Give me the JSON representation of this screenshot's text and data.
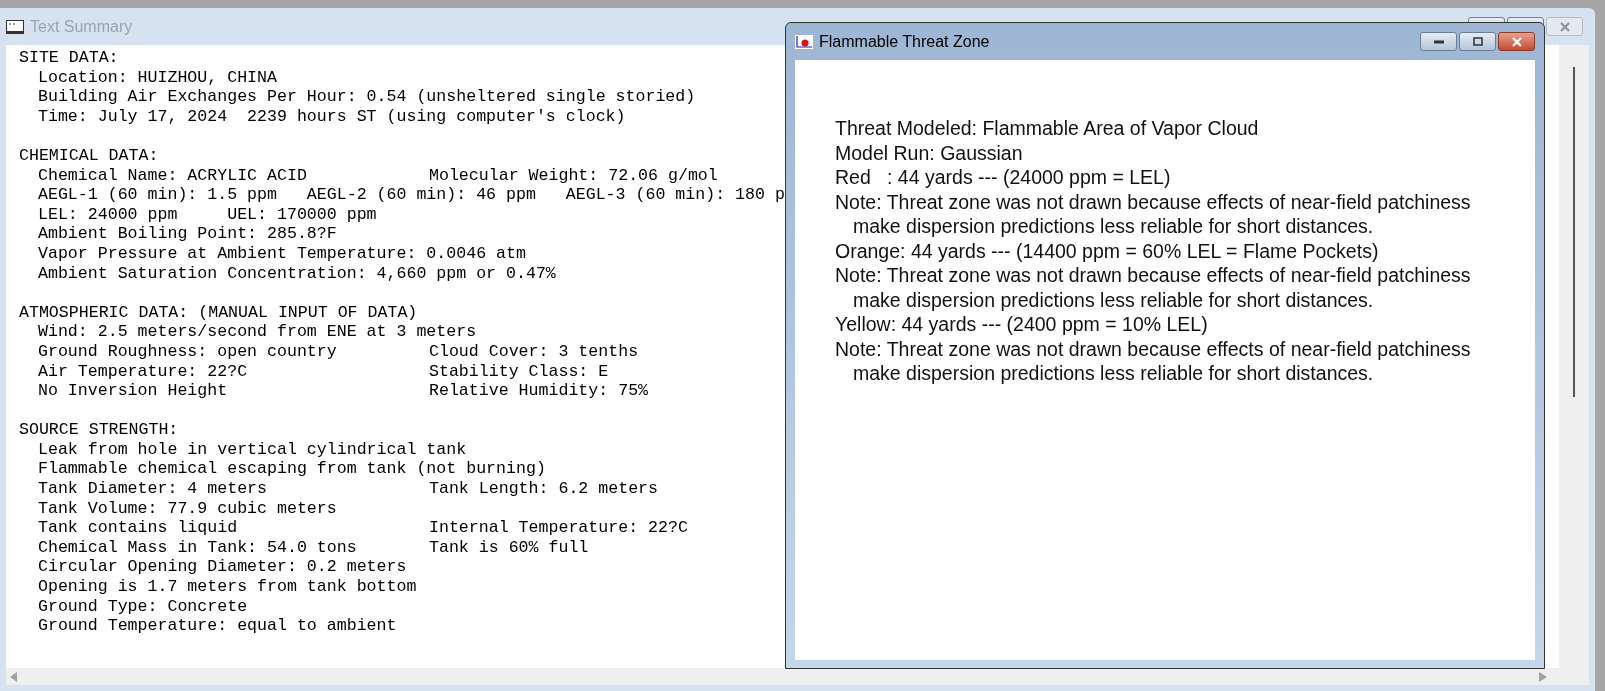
{
  "summary_window": {
    "title": "Text Summary",
    "sections": [
      {
        "heading": "SITE DATA:",
        "lines": [
          {
            "left": "Location: HUIZHOU, CHINA"
          },
          {
            "left": "Building Air Exchanges Per Hour: 0.54 (unsheltered single storied)"
          },
          {
            "left": "Time: July 17, 2024  2239 hours ST (using computer's clock)"
          }
        ]
      },
      {
        "heading": "CHEMICAL DATA:",
        "lines": [
          {
            "left": "Chemical Name: ACRYLIC ACID",
            "right": "Molecular Weight: 72.06 g/mol"
          },
          {
            "left": "AEGL-1 (60 min): 1.5 ppm   AEGL-2 (60 min): 46 ppm   AEGL-3 (60 min): 180 p"
          },
          {
            "left": "LEL: 24000 ppm     UEL: 170000 ppm"
          },
          {
            "left": "Ambient Boiling Point: 285.8?F"
          },
          {
            "left": "Vapor Pressure at Ambient Temperature: 0.0046 atm"
          },
          {
            "left": "Ambient Saturation Concentration: 4,660 ppm or 0.47%"
          }
        ]
      },
      {
        "heading": "ATMOSPHERIC DATA: (MANUAL INPUT OF DATA)",
        "lines": [
          {
            "left": "Wind: 2.5 meters/second from ENE at 3 meters"
          },
          {
            "left": "Ground Roughness: open country",
            "right": "Cloud Cover: 3 tenths"
          },
          {
            "left": "Air Temperature: 22?C",
            "right": "Stability Class: E"
          },
          {
            "left": "No Inversion Height",
            "right": "Relative Humidity: 75%"
          }
        ]
      },
      {
        "heading": "SOURCE STRENGTH:",
        "lines": [
          {
            "left": "Leak from hole in vertical cylindrical tank"
          },
          {
            "left": "Flammable chemical escaping from tank (not burning)"
          },
          {
            "left": "Tank Diameter: 4 meters",
            "right": "Tank Length: 6.2 meters"
          },
          {
            "left": "Tank Volume: 77.9 cubic meters"
          },
          {
            "left": "Tank contains liquid",
            "right": "Internal Temperature: 22?C"
          },
          {
            "left": "Chemical Mass in Tank: 54.0 tons",
            "right": "Tank is 60% full"
          },
          {
            "left": "Circular Opening Diameter: 0.2 meters"
          },
          {
            "left": "Opening is 1.7 meters from tank bottom"
          },
          {
            "left": "Ground Type: Concrete"
          },
          {
            "left": "Ground Temperature: equal to ambient"
          }
        ]
      }
    ]
  },
  "threat_window": {
    "title": "Flammable Threat Zone",
    "lines": [
      {
        "kind": "plain",
        "text": "Threat Modeled: Flammable Area of Vapor Cloud"
      },
      {
        "kind": "plain",
        "text": "Model Run: Gaussian"
      },
      {
        "kind": "plain",
        "text": "Red   : 44 yards --- (24000 ppm = LEL)"
      },
      {
        "kind": "note",
        "text": "Note: Threat zone was not drawn because effects of near-field patchiness",
        "continuation": "make dispersion predictions less reliable for short distances."
      },
      {
        "kind": "plain",
        "text": "Orange: 44 yards --- (14400 ppm = 60% LEL = Flame Pockets)"
      },
      {
        "kind": "note",
        "text": "Note: Threat zone was not drawn because effects of near-field patchiness",
        "continuation": "make dispersion predictions less reliable for short distances."
      },
      {
        "kind": "plain",
        "text": "Yellow: 44 yards --- (2400 ppm = 10% LEL)"
      },
      {
        "kind": "note",
        "text": "Note: Threat zone was not drawn because effects of near-field patchiness",
        "continuation": "make dispersion predictions less reliable for short distances."
      }
    ]
  }
}
